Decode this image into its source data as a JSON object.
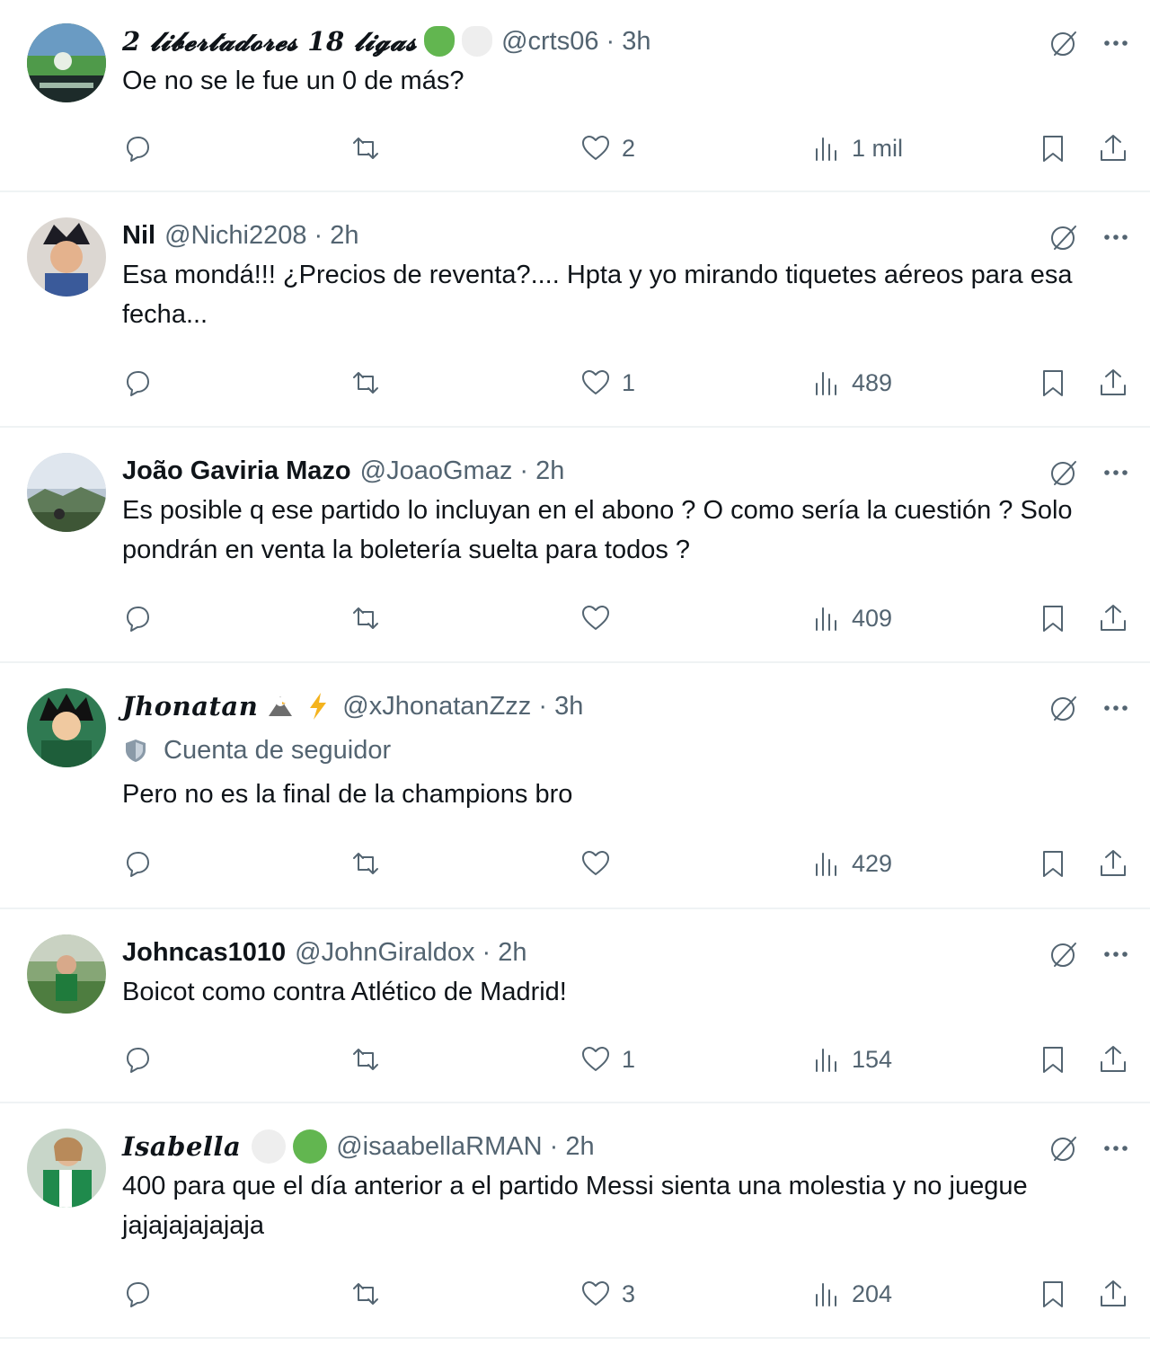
{
  "colors": {
    "text": "#0f1419",
    "secondary": "#536471",
    "divider": "#eff3f4",
    "green_emoji": "#62b650",
    "white_emoji": "#eeeeee"
  },
  "posts": [
    {
      "name": "2 𝓵𝓲𝓫𝓮𝓻𝓽𝓪𝓭𝓸𝓻𝓮𝓼 18 𝓵𝓲𝓰𝓪𝓼",
      "emojis": [
        "green-heart-icon",
        "white-heart-icon"
      ],
      "handle": "@crts06",
      "time": "3h",
      "text": "Oe no se le fue un 0 de más?",
      "replies": "",
      "reposts": "",
      "likes": "2",
      "views": "1 mil"
    },
    {
      "name": "Nil",
      "handle": "@Nichi2208",
      "time": "2h",
      "text": "Esa mondá!!! ¿Precios de reventa?.... Hpta y yo mirando tiquetes aéreos para esa fecha...",
      "replies": "",
      "reposts": "",
      "likes": "1",
      "views": "489"
    },
    {
      "name": "João Gaviria Mazo",
      "handle": "@JoaoGmaz",
      "time": "2h",
      "text": "Es posible q ese partido lo incluyan en el abono ? O como sería la cuestión ? Solo pondrán en venta la boletería suelta para todos ?",
      "replies": "",
      "reposts": "",
      "likes": "",
      "views": "409"
    },
    {
      "name": "Jhonatan",
      "emojis": [
        "eagle-icon",
        "lightning-icon"
      ],
      "handle": "@xJhonatanZzz",
      "time": "3h",
      "follower_label": "Cuenta de seguidor",
      "text": "Pero no es la final de la champions bro",
      "replies": "",
      "reposts": "",
      "likes": "",
      "views": "429"
    },
    {
      "name": "Johncas1010",
      "handle": "@JohnGiraldox",
      "time": "2h",
      "text": "Boicot como contra Atlético de Madrid!",
      "replies": "",
      "reposts": "",
      "likes": "1",
      "views": "154"
    },
    {
      "name": "Isabella",
      "emojis": [
        "white-circle-icon",
        "green-circle-icon"
      ],
      "handle": "@isaabellaRMAN",
      "time": "2h",
      "text": "400 para que el día anterior a el partido Messi sienta una molestia y no juegue jajajajajajaja",
      "replies": "",
      "reposts": "",
      "likes": "3",
      "views": "204"
    }
  ]
}
